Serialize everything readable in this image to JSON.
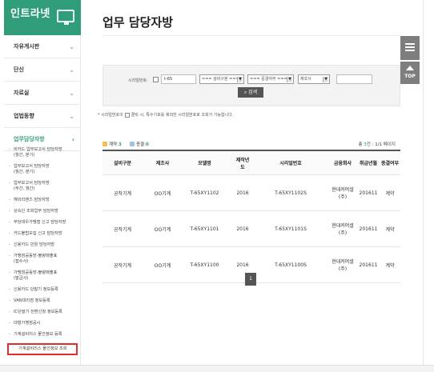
{
  "brand": {
    "title": "인트라넷",
    "icon": "monitor-icon",
    "color": "#2f9d7a"
  },
  "nav": [
    {
      "label": "자유게시판"
    },
    {
      "label": "단신"
    },
    {
      "label": "자료실"
    },
    {
      "label": "업법동향"
    },
    {
      "label": "업무담당자방"
    }
  ],
  "subnav": [
    "비카드 업무보고서 담당자방\n(월간, 분기)",
    "업무보고서 담당자방\n(월간, 분기)",
    "업무보고서 담당자방\n(주간, 월간)",
    "해외리멘즈 담당자방",
    "상속인 조회업무 담당자방",
    "부당대우가맹점 신고 담당자방",
    "카드불법모집 신고 담당자방",
    "신용카드 민원 담당자방",
    "가맹점공동망-불량매출표\n(접수사)",
    "가맹점공동망-불량매출표\n(발급사)",
    "신용카드 단말기 정보등록",
    "VAN대리점 정보등록",
    "IC단말기 전환신청 정보등록",
    "대형가맹점공시",
    "기계설비리스 물건정보 등록",
    "기계설비리스 물건정보 조회"
  ],
  "page": {
    "title": "업무 담당자방",
    "crumb": ""
  },
  "search": {
    "serial_label": "시리얼번호:",
    "serial_value": "t-65",
    "select1": "=== 설비구분 ===",
    "select2": "=== 중결여부 ===",
    "select3": "제조사",
    "extra_value": "",
    "button": "검색"
  },
  "note": {
    "prefix": "* 시리얼번호의",
    "suffix": "클릭 시, 특수기호를 제외한 시리얼번호로 조회가 가능합니다."
  },
  "list": {
    "progress_label": "계약:",
    "progress_value": "3",
    "done_label": "종결:",
    "done_value": "0",
    "total_prefix": "총",
    "total_value": "3",
    "total_suffix": "건 : 1/1 페이지"
  },
  "table": {
    "headers": [
      "설비구분",
      "제조사",
      "모델명",
      "제작년도",
      "시리얼번호",
      "금융회사",
      "취급년월",
      "종결여부"
    ],
    "rows": [
      [
        "공작기계",
        "OO기계",
        "T-65XY1102",
        "2016",
        "T-65XY1102S",
        "현대커머셜(주)",
        "201611",
        "계약"
      ],
      [
        "공작기계",
        "OO기계",
        "T-65XY1101",
        "2016",
        "T-65XY1101S",
        "현대커머셜(주)",
        "201611",
        "계약"
      ],
      [
        "공작기계",
        "OO기계",
        "T-65XY1100",
        "2016",
        "T-65XY1100S",
        "현대커머셜(주)",
        "201611",
        "계약"
      ]
    ]
  },
  "pager": {
    "current": "1"
  },
  "float": {
    "menu_icon": "list-icon",
    "top_label": "TOP"
  }
}
